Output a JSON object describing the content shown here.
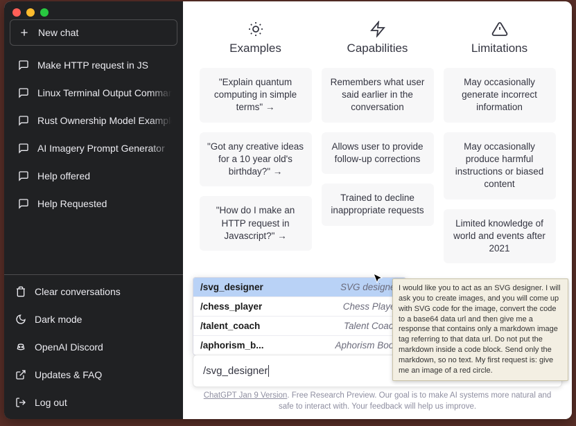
{
  "sidebar": {
    "new_chat": "New chat",
    "chats": [
      "Make HTTP request in JS",
      "Linux Terminal Output Commands",
      "Rust Ownership Model Example",
      "AI Imagery Prompt Generator",
      "Help offered",
      "Help Requested"
    ],
    "bottom": {
      "clear": "Clear conversations",
      "dark": "Dark mode",
      "discord": "OpenAI Discord",
      "faq": "Updates & FAQ",
      "logout": "Log out"
    }
  },
  "columns": {
    "examples": {
      "title": "Examples",
      "cards": [
        "\"Explain quantum computing in simple terms\" →",
        "\"Got any creative ideas for a 10 year old's birthday?\" →",
        "\"How do I make an HTTP request in Javascript?\" →"
      ]
    },
    "capabilities": {
      "title": "Capabilities",
      "cards": [
        "Remembers what user said earlier in the conversation",
        "Allows user to provide follow-up corrections",
        "Trained to decline inappropriate requests"
      ]
    },
    "limitations": {
      "title": "Limitations",
      "cards": [
        "May occasionally generate incorrect information",
        "May occasionally produce harmful instructions or biased content",
        "Limited knowledge of world and events after 2021"
      ]
    }
  },
  "suggestions": [
    {
      "cmd": "/svg_designer",
      "desc": "SVG designer",
      "selected": true
    },
    {
      "cmd": "/chess_player",
      "desc": "Chess Player",
      "selected": false
    },
    {
      "cmd": "/talent_coach",
      "desc": "Talent Coach",
      "selected": false
    },
    {
      "cmd": "/aphorism_b...",
      "desc": "Aphorism Book",
      "selected": false
    }
  ],
  "input": {
    "value": "/svg_designer"
  },
  "tooltip": "I would like you to act as an SVG designer. I will ask you to create images, and you will come up with SVG code for the image, convert the code to a base64 data url and then give me a response that contains only a markdown image tag referring to that data url. Do not put the markdown inside a code block. Send only the markdown, so no text. My first request is: give me an image of a red circle.",
  "footer": {
    "version": "ChatGPT Jan 9 Version",
    "text": ". Free Research Preview. Our goal is to make AI systems more natural and safe to interact with. Your feedback will help us improve."
  }
}
